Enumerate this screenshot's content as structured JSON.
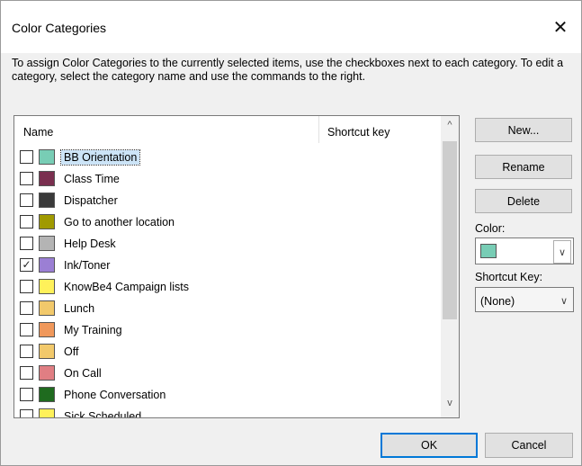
{
  "window": {
    "title": "Color Categories",
    "close_glyph": "✕"
  },
  "instructions": "To assign Color Categories to the currently selected items, use the checkboxes next to each category.  To edit a category, select the category name and use the commands to the right.",
  "list": {
    "header_name": "Name",
    "header_shortcut": "Shortcut key",
    "scroll_up": "^",
    "scroll_down": "v",
    "items": [
      {
        "label": "BB Orientation",
        "color": "#78cdb5",
        "checked": false,
        "selected": true
      },
      {
        "label": "Class  Time",
        "color": "#7a2f4f",
        "checked": false,
        "selected": false
      },
      {
        "label": "Dispatcher",
        "color": "#3a3a3a",
        "checked": false,
        "selected": false
      },
      {
        "label": "Go to another location",
        "color": "#a09a00",
        "checked": false,
        "selected": false
      },
      {
        "label": "Help Desk",
        "color": "#b4b4b4",
        "checked": false,
        "selected": false
      },
      {
        "label": "Ink/Toner",
        "color": "#9b7fd4",
        "checked": true,
        "selected": false
      },
      {
        "label": "KnowBe4 Campaign lists",
        "color": "#fff15a",
        "checked": false,
        "selected": false
      },
      {
        "label": "Lunch",
        "color": "#f2c96b",
        "checked": false,
        "selected": false
      },
      {
        "label": "My Training",
        "color": "#f0985b",
        "checked": false,
        "selected": false
      },
      {
        "label": "Off",
        "color": "#f2c96b",
        "checked": false,
        "selected": false
      },
      {
        "label": "On Call",
        "color": "#e07e83",
        "checked": false,
        "selected": false
      },
      {
        "label": "Phone Conversation",
        "color": "#1f6b1f",
        "checked": false,
        "selected": false
      },
      {
        "label": "Sick Scheduled",
        "color": "#fff15a",
        "checked": false,
        "selected": false
      }
    ]
  },
  "buttons": {
    "new": "New...",
    "rename": "Rename",
    "delete": "Delete",
    "ok": "OK",
    "cancel": "Cancel"
  },
  "color_field": {
    "label": "Color:",
    "value_color": "#78cdb5",
    "arrow": "∨"
  },
  "shortcut_field": {
    "label": "Shortcut Key:",
    "value": "(None)",
    "arrow": "∨"
  }
}
